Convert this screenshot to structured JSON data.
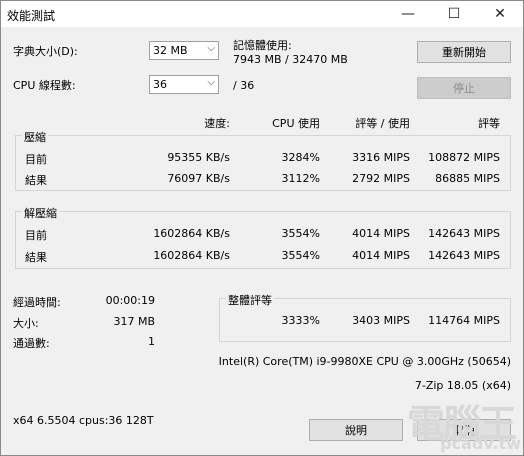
{
  "window": {
    "title": "效能測試",
    "min_glyph": "—",
    "max_glyph": "☐",
    "close_glyph": "✕"
  },
  "settings": {
    "dict_label": "字典大小(D):",
    "dict_value": "32 MB",
    "cpu_threads_label": "CPU 線程數:",
    "cpu_threads_value": "36",
    "cpu_threads_total": "/ 36",
    "memory_label": "記憶體使用:",
    "memory_value": "7943 MB / 32470 MB"
  },
  "buttons": {
    "restart": "重新開始",
    "stop": "停止",
    "help": "說明",
    "cancel": "取消"
  },
  "columns": {
    "speed": "速度:",
    "cpu_usage": "CPU 使用",
    "rating_usage": "評等 / 使用",
    "rating": "評等"
  },
  "compress": {
    "title": "壓縮",
    "rows": [
      {
        "label": "目前",
        "speed": "95355 KB/s",
        "cpu": "3284%",
        "rpu": "3316 MIPS",
        "rating": "108872 MIPS"
      },
      {
        "label": "結果",
        "speed": "76097 KB/s",
        "cpu": "3112%",
        "rpu": "2792 MIPS",
        "rating": "86885 MIPS"
      }
    ]
  },
  "decompress": {
    "title": "解壓縮",
    "rows": [
      {
        "label": "目前",
        "speed": "1602864 KB/s",
        "cpu": "3554%",
        "rpu": "4014 MIPS",
        "rating": "142643 MIPS"
      },
      {
        "label": "結果",
        "speed": "1602864 KB/s",
        "cpu": "3554%",
        "rpu": "4014 MIPS",
        "rating": "142643 MIPS"
      }
    ]
  },
  "stats": {
    "elapsed_label": "經過時間:",
    "elapsed_value": "00:00:19",
    "size_label": "大小:",
    "size_value": "317 MB",
    "passes_label": "通過數:",
    "passes_value": "1"
  },
  "total": {
    "title": "整體評等",
    "cpu": "3333%",
    "rpu": "3403 MIPS",
    "rating": "114764 MIPS"
  },
  "system": {
    "cpu_info": "Intel(R) Core(TM) i9-9980XE CPU @ 3.00GHz (50654)",
    "version": "7-Zip 18.05 (x64)",
    "arch": "x64 6.5504 cpus:36 128T"
  },
  "watermark": {
    "logo": "電腦王",
    "url": "pcadv.tw"
  }
}
